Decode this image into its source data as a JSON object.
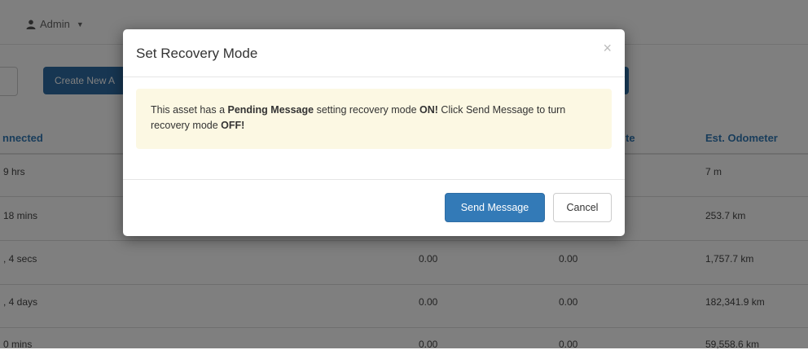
{
  "topbar": {
    "user_label": "Admin"
  },
  "toolbar": {
    "create_label": "Create New A"
  },
  "table": {
    "headers": {
      "connected": "nnected",
      "rate_partial": "te",
      "odometer": "Est. Odometer"
    },
    "rows": [
      {
        "connected": "9 hrs",
        "col_a": "",
        "col_b": "",
        "odometer": "7 m"
      },
      {
        "connected": "18 mins",
        "col_a": "",
        "col_b": "",
        "odometer": "253.7 km"
      },
      {
        "connected": ", 4 secs",
        "col_a": "0.00",
        "col_b": "0.00",
        "odometer": "1,757.7 km"
      },
      {
        "connected": ", 4 days",
        "col_a": "0.00",
        "col_b": "0.00",
        "odometer": "182,341.9 km"
      },
      {
        "connected": "0 mins",
        "col_a": "0.00",
        "col_b": "0.00",
        "odometer": "59,558.6 km"
      }
    ]
  },
  "modal": {
    "title": "Set Recovery Mode",
    "close_glyph": "×",
    "alert": {
      "t1": "This asset has a ",
      "b1": "Pending Message",
      "t2": " setting recovery mode ",
      "b2": "ON!",
      "t3": " Click Send Message to turn recovery mode ",
      "b3": "OFF!"
    },
    "send_label": "Send Message",
    "cancel_label": "Cancel"
  },
  "colors": {
    "primary": "#337ab7",
    "alert_bg": "#fcf8e3",
    "link": "#337ab7",
    "backdrop": "rgba(0,0,0,0.5)"
  }
}
